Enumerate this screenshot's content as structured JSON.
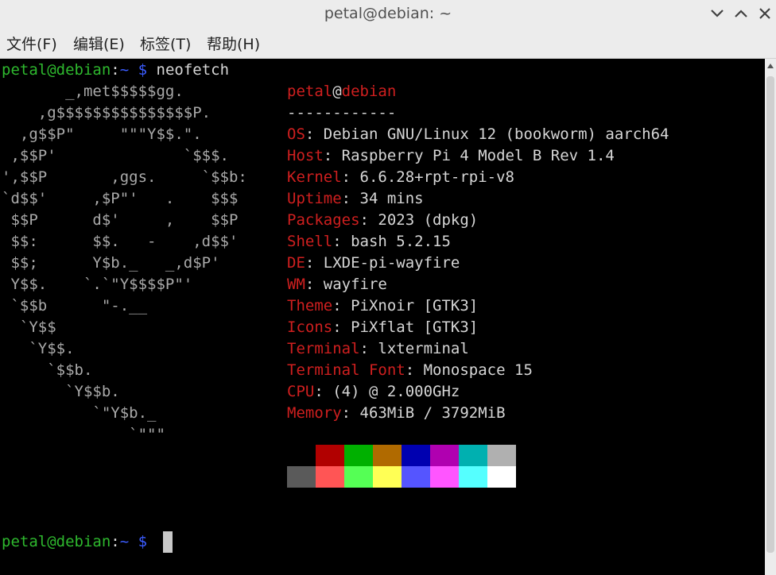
{
  "window": {
    "title": "petal@debian: ~"
  },
  "menu": [
    "文件(F)",
    "编辑(E)",
    "标签(T)",
    "帮助(H)"
  ],
  "prompt": {
    "user_host": "petal@debian",
    "sep": ":",
    "path": "~",
    "symbol": "$",
    "command": "neofetch"
  },
  "logo_lines": [
    "       _,met$$$$$gg.",
    "    ,g$$$$$$$$$$$$$$$P.",
    "  ,g$$P\"     \"\"\"Y$$.\".",
    " ,$$P'              `$$$.",
    "',$$P       ,ggs.     `$$b:",
    "`d$$'     ,$P\"'   .    $$$",
    " $$P      d$'     ,    $$P",
    " $$:      $$.   -    ,d$$'",
    " $$;      Y$b._   _,d$P'",
    " Y$$.    `.`\"Y$$$$P\"'",
    " `$$b      \"-.__",
    "  `Y$$",
    "   `Y$$.",
    "     `$$b.",
    "       `Y$$b.",
    "          `\"Y$b._",
    "              `\"\"\""
  ],
  "info": {
    "user": "petal",
    "at": "@",
    "host": "debian",
    "separator": "------------",
    "rows": [
      {
        "key": "OS",
        "value": "Debian GNU/Linux 12 (bookworm) aarch64"
      },
      {
        "key": "Host",
        "value": "Raspberry Pi 4 Model B Rev 1.4"
      },
      {
        "key": "Kernel",
        "value": "6.6.28+rpt-rpi-v8"
      },
      {
        "key": "Uptime",
        "value": "34 mins"
      },
      {
        "key": "Packages",
        "value": "2023 (dpkg)"
      },
      {
        "key": "Shell",
        "value": "bash 5.2.15"
      },
      {
        "key": "DE",
        "value": "LXDE-pi-wayfire"
      },
      {
        "key": "WM",
        "value": "wayfire"
      },
      {
        "key": "Theme",
        "value": "PiXnoir [GTK3]"
      },
      {
        "key": "Icons",
        "value": "PiXflat [GTK3]"
      },
      {
        "key": "Terminal",
        "value": "lxterminal"
      },
      {
        "key": "Terminal Font",
        "value": "Monospace 15"
      },
      {
        "key": "CPU",
        "value": "(4) @ 2.000GHz"
      },
      {
        "key": "Memory",
        "value": "463MiB / 3792MiB"
      }
    ]
  },
  "palette": {
    "normal": [
      "#000000",
      "#b10000",
      "#00b000",
      "#b06a00",
      "#0000b0",
      "#b000b0",
      "#00b0b0",
      "#b0b0b0"
    ],
    "bright": [
      "#5a5a5a",
      "#ff5555",
      "#55ff55",
      "#ffff55",
      "#5555ff",
      "#ff55ff",
      "#55ffff",
      "#ffffff"
    ]
  }
}
